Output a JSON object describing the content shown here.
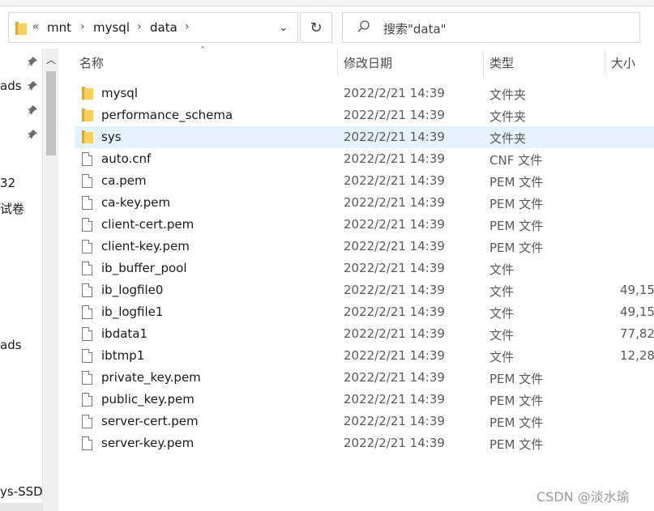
{
  "address": {
    "overflow": "«",
    "crumbs": [
      "mnt",
      "mysql",
      "data"
    ],
    "separator": "›",
    "dropdown": "⌄"
  },
  "refresh_glyph": "↻",
  "search": {
    "placeholder": "搜索\"data\"",
    "icon": "search-icon"
  },
  "nav": {
    "items": [
      "ads",
      "32",
      "试卷",
      "ads",
      "ys-SSD ("
    ],
    "scroll_up": "︿"
  },
  "columns": {
    "name": "名称",
    "date": "修改日期",
    "type": "类型",
    "size": "大小",
    "sort_glyph": "˄"
  },
  "files": [
    {
      "name": "mysql",
      "date": "2022/2/21 14:39",
      "type": "文件夹",
      "size": "",
      "kind": "folder"
    },
    {
      "name": "performance_schema",
      "date": "2022/2/21 14:39",
      "type": "文件夹",
      "size": "",
      "kind": "folder"
    },
    {
      "name": "sys",
      "date": "2022/2/21 14:39",
      "type": "文件夹",
      "size": "",
      "kind": "folder",
      "selected": true
    },
    {
      "name": "auto.cnf",
      "date": "2022/2/21 14:39",
      "type": "CNF 文件",
      "size": "",
      "kind": "file"
    },
    {
      "name": "ca.pem",
      "date": "2022/2/21 14:39",
      "type": "PEM 文件",
      "size": "",
      "kind": "file"
    },
    {
      "name": "ca-key.pem",
      "date": "2022/2/21 14:39",
      "type": "PEM 文件",
      "size": "",
      "kind": "file"
    },
    {
      "name": "client-cert.pem",
      "date": "2022/2/21 14:39",
      "type": "PEM 文件",
      "size": "",
      "kind": "file"
    },
    {
      "name": "client-key.pem",
      "date": "2022/2/21 14:39",
      "type": "PEM 文件",
      "size": "",
      "kind": "file"
    },
    {
      "name": "ib_buffer_pool",
      "date": "2022/2/21 14:39",
      "type": "文件",
      "size": "",
      "kind": "file"
    },
    {
      "name": "ib_logfile0",
      "date": "2022/2/21 14:39",
      "type": "文件",
      "size": "49,15",
      "kind": "file"
    },
    {
      "name": "ib_logfile1",
      "date": "2022/2/21 14:39",
      "type": "文件",
      "size": "49,15",
      "kind": "file"
    },
    {
      "name": "ibdata1",
      "date": "2022/2/21 14:39",
      "type": "文件",
      "size": "77,82",
      "kind": "file"
    },
    {
      "name": "ibtmp1",
      "date": "2022/2/21 14:39",
      "type": "文件",
      "size": "12,28",
      "kind": "file"
    },
    {
      "name": "private_key.pem",
      "date": "2022/2/21 14:39",
      "type": "PEM 文件",
      "size": "",
      "kind": "file"
    },
    {
      "name": "public_key.pem",
      "date": "2022/2/21 14:39",
      "type": "PEM 文件",
      "size": "",
      "kind": "file"
    },
    {
      "name": "server-cert.pem",
      "date": "2022/2/21 14:39",
      "type": "PEM 文件",
      "size": "",
      "kind": "file"
    },
    {
      "name": "server-key.pem",
      "date": "2022/2/21 14:39",
      "type": "PEM 文件",
      "size": "",
      "kind": "file"
    }
  ],
  "watermark": "CSDN @淡水瑜",
  "colors": {
    "selected_row": "#e5f3ff",
    "folder": "#f8cf5a"
  }
}
